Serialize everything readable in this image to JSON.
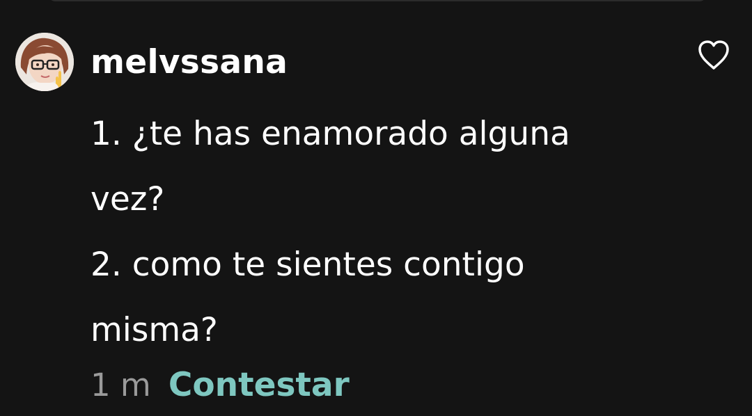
{
  "comment": {
    "username": "melvssana",
    "lines": [
      "1. ¿te has enamorado alguna",
      "vez?",
      "2. como te sientes contigo",
      "misma?"
    ],
    "time": "1 m",
    "reply_label": "Contestar",
    "avatar_icon": "user-avatar-photo",
    "like_icon": "heart-outline-icon"
  },
  "colors": {
    "background": "#141414",
    "text": "#ffffff",
    "muted": "#9a9a9a",
    "accent": "#7ec7c0"
  }
}
